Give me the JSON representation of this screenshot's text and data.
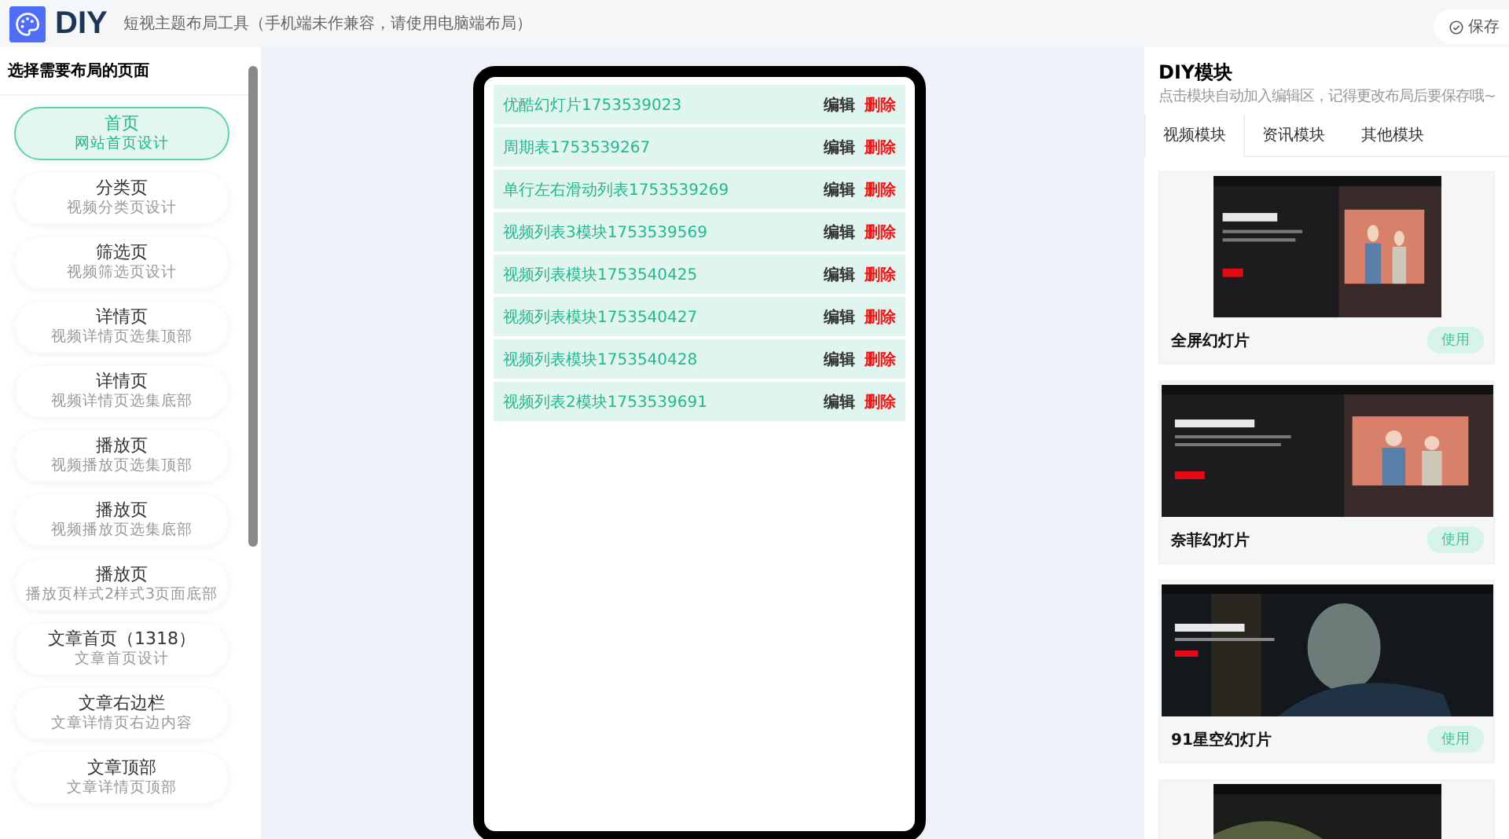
{
  "header": {
    "logo": "DIY",
    "subtitle": "短视主题布局工具（手机端未作兼容，请使用电脑端布局）",
    "save_button": "保存"
  },
  "sidebar": {
    "title": "选择需要布局的页面",
    "items": [
      {
        "title": "首页",
        "subtitle": "网站首页设计",
        "selected": true
      },
      {
        "title": "分类页",
        "subtitle": "视频分类页设计",
        "selected": false
      },
      {
        "title": "筛选页",
        "subtitle": "视频筛选页设计",
        "selected": false
      },
      {
        "title": "详情页",
        "subtitle": "视频详情页选集顶部",
        "selected": false
      },
      {
        "title": "详情页",
        "subtitle": "视频详情页选集底部",
        "selected": false
      },
      {
        "title": "播放页",
        "subtitle": "视频播放页选集顶部",
        "selected": false
      },
      {
        "title": "播放页",
        "subtitle": "视频播放页选集底部",
        "selected": false
      },
      {
        "title": "播放页",
        "subtitle": "播放页样式2样式3页面底部",
        "selected": false
      },
      {
        "title": "文章首页（1318）",
        "subtitle": "文章首页设计",
        "selected": false
      },
      {
        "title": "文章右边栏",
        "subtitle": "文章详情页右边内容",
        "selected": false
      },
      {
        "title": "文章顶部",
        "subtitle": "文章详情页顶部",
        "selected": false
      }
    ]
  },
  "editor": {
    "blocks": [
      {
        "name": "优酷幻灯片1753539023",
        "edit": "编辑",
        "delete": "删除"
      },
      {
        "name": "周期表1753539267",
        "edit": "编辑",
        "delete": "删除"
      },
      {
        "name": "单行左右滑动列表1753539269",
        "edit": "编辑",
        "delete": "删除"
      },
      {
        "name": "视频列表3模块1753539569",
        "edit": "编辑",
        "delete": "删除"
      },
      {
        "name": "视频列表模块1753540425",
        "edit": "编辑",
        "delete": "删除"
      },
      {
        "name": "视频列表模块1753540427",
        "edit": "编辑",
        "delete": "删除"
      },
      {
        "name": "视频列表模块1753540428",
        "edit": "编辑",
        "delete": "删除"
      },
      {
        "name": "视频列表2模块1753539691",
        "edit": "编辑",
        "delete": "删除"
      }
    ]
  },
  "modules_panel": {
    "title": "DIY模块",
    "hint": "点击模块自动加入编辑区，记得更改布局后要保存哦~",
    "tabs": [
      {
        "label": "视频模块",
        "selected": true
      },
      {
        "label": "资讯模块",
        "selected": false
      },
      {
        "label": "其他模块",
        "selected": false
      }
    ],
    "modules": [
      {
        "kind": "narrow",
        "title": "全屏幻灯片",
        "button": "使用"
      },
      {
        "kind": "wide",
        "title": "奈菲幻灯片",
        "button": "使用"
      },
      {
        "kind": "wide",
        "title": "91星空幻灯片",
        "button": "使用"
      },
      {
        "kind": "narrow"
      }
    ]
  }
}
